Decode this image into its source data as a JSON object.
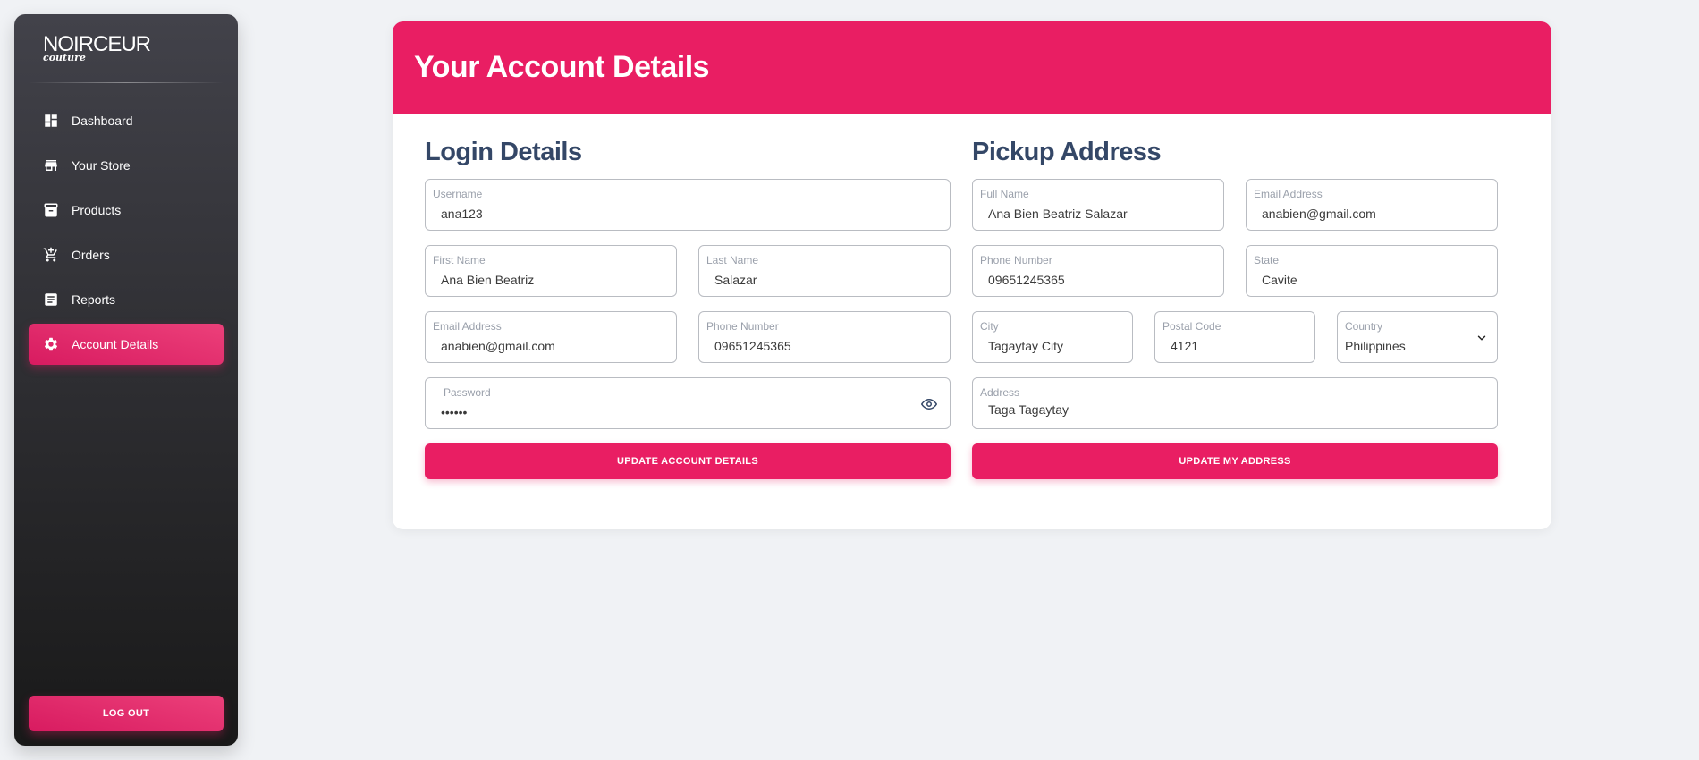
{
  "brand": {
    "name": "NOIRCEUR",
    "tagline": "couture"
  },
  "sidebar": {
    "items": [
      {
        "label": "Dashboard",
        "icon": "dashboard-icon"
      },
      {
        "label": "Your Store",
        "icon": "store-icon"
      },
      {
        "label": "Products",
        "icon": "archive-icon"
      },
      {
        "label": "Orders",
        "icon": "cart-icon"
      },
      {
        "label": "Reports",
        "icon": "report-icon"
      },
      {
        "label": "Account Details",
        "icon": "gear-icon",
        "active": true
      }
    ],
    "logout_label": "LOG OUT"
  },
  "page": {
    "title": "Your Account Details"
  },
  "login": {
    "title": "Login Details",
    "username": {
      "label": "Username",
      "value": "ana123"
    },
    "first_name": {
      "label": "First Name",
      "value": "Ana Bien Beatriz"
    },
    "last_name": {
      "label": "Last Name",
      "value": "Salazar"
    },
    "email": {
      "label": "Email Address",
      "value": "anabien@gmail.com"
    },
    "phone": {
      "label": "Phone Number",
      "value": "09651245365"
    },
    "password": {
      "label": "Password",
      "value": "••••••"
    },
    "button_label": "UPDATE ACCOUNT DETAILS"
  },
  "pickup": {
    "title": "Pickup Address",
    "full_name": {
      "label": "Full Name",
      "value": "Ana Bien Beatriz Salazar"
    },
    "email": {
      "label": "Email Address",
      "value": "anabien@gmail.com"
    },
    "phone": {
      "label": "Phone Number",
      "value": "09651245365"
    },
    "state": {
      "label": "State",
      "value": "Cavite"
    },
    "city": {
      "label": "City",
      "value": "Tagaytay City"
    },
    "postal_code": {
      "label": "Postal Code",
      "value": "4121"
    },
    "country": {
      "label": "Country",
      "value": "Philippines"
    },
    "address": {
      "label": "Address",
      "value": "Taga Tagaytay"
    },
    "button_label": "UPDATE MY ADDRESS"
  },
  "colors": {
    "accent": "#e91e63",
    "heading": "#344767",
    "background": "#f0f2f5"
  }
}
